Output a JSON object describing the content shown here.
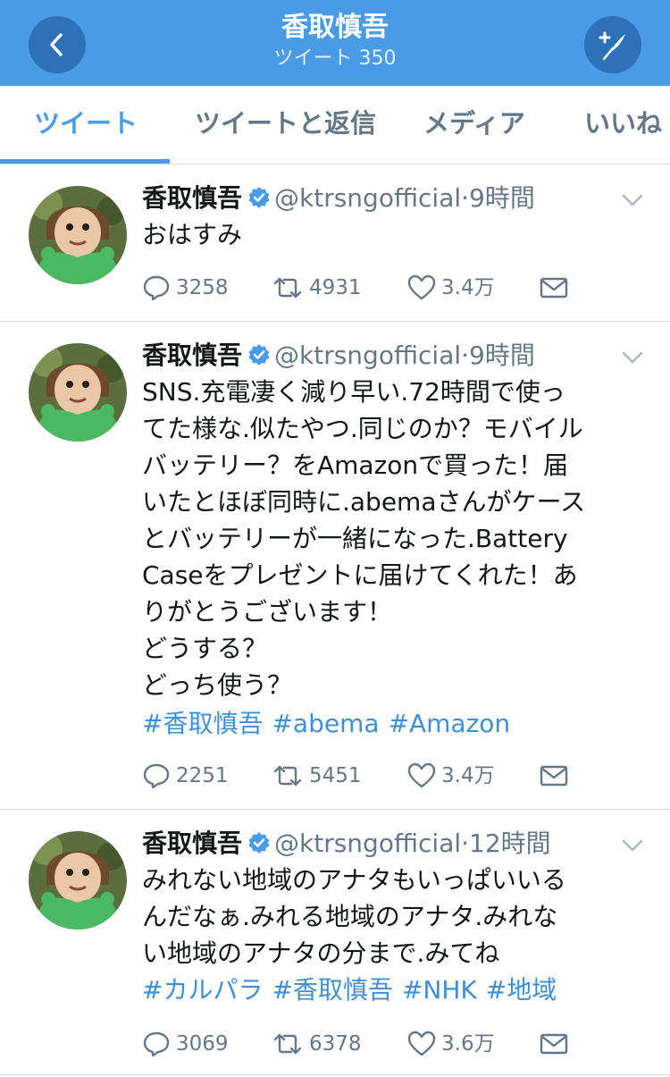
{
  "header": {
    "title": "香取慎吾",
    "subtitle": "ツイート 350"
  },
  "tabs": [
    {
      "label": "ツイート",
      "active": true
    },
    {
      "label": "ツイートと返信",
      "active": false
    },
    {
      "label": "メディア",
      "active": false
    },
    {
      "label": "いいね",
      "active": false
    }
  ],
  "colors": {
    "accent": "#4a9be6",
    "header_button": "#2d72b8",
    "hashtag": "#3f8fd6",
    "muted": "#657786"
  },
  "icons": [
    "back-chevron-icon",
    "compose-quill-icon",
    "verified-badge-icon",
    "chevron-down-icon",
    "reply-icon",
    "retweet-icon",
    "like-heart-icon",
    "direct-message-icon"
  ],
  "tweets": [
    {
      "name": "香取慎吾",
      "handle": "@ktrsngofficial",
      "separator": "·",
      "time": "9時間",
      "text": "おはすみ",
      "hashtags": [],
      "replies": "3258",
      "retweets": "4931",
      "likes": "3.4万"
    },
    {
      "name": "香取慎吾",
      "handle": "@ktrsngofficial",
      "separator": "·",
      "time": "9時間",
      "text": "SNS.充電凄く減り早い.72時間で使っ\nてた様な.似たやつ.同じのか？モバイル\nバッテリー？をAmazonで買った！届\nいたとほぼ同時に.abemaさんがケース\nとバッテリーが一緒になった.Battery\nCaseをプレゼントに届けてくれた！あ\nりがとうございます！\nどうする？\nどっち使う？",
      "hashtags": [
        "#香取慎吾",
        "#abema",
        "#Amazon"
      ],
      "replies": "2251",
      "retweets": "5451",
      "likes": "3.4万"
    },
    {
      "name": "香取慎吾",
      "handle": "@ktrsngofficial",
      "separator": "·",
      "time": "12時間",
      "text": "みれない地域のアナタもいっぱいいる\nんだなぁ.みれる地域のアナタ.みれな\nい地域のアナタの分まで.みてね",
      "hashtags": [
        "#カルパラ",
        "#香取慎吾",
        "#NHK",
        "#地域"
      ],
      "replies": "3069",
      "retweets": "6378",
      "likes": "3.6万"
    }
  ]
}
